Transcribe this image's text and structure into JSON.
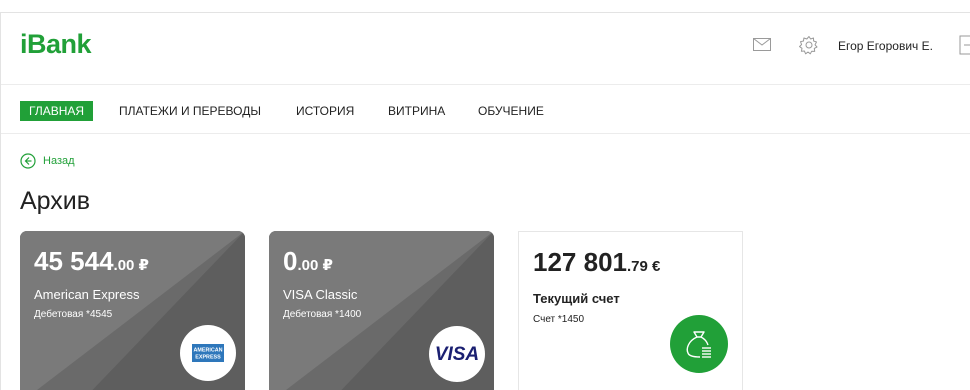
{
  "header": {
    "logo": "iBank",
    "user_name": "Егор Егорович Е.",
    "icons": [
      "mail-icon",
      "gear-icon",
      "logout-icon"
    ]
  },
  "nav": {
    "items": [
      {
        "label": "ГЛАВНАЯ",
        "active": true
      },
      {
        "label": "ПЛАТЕЖИ И ПЕРЕВОДЫ",
        "active": false
      },
      {
        "label": "ИСТОРИЯ",
        "active": false
      },
      {
        "label": "ВИТРИНА",
        "active": false
      },
      {
        "label": "ОБУЧЕНИЕ",
        "active": false
      }
    ]
  },
  "back": {
    "label": "Назад"
  },
  "page_title": "Архив",
  "cards": [
    {
      "amount_main": "45 544",
      "amount_fraction": ".00 ₽",
      "name": "American Express",
      "subtitle": "Дебетовая *4545",
      "logo": "amex-logo",
      "logo_text_top": "AMERICAN",
      "logo_text_bottom": "EXPRESS"
    },
    {
      "amount_main": "0",
      "amount_fraction": ".00 ₽",
      "name": "VISA Classic",
      "subtitle": "Дебетовая *1400",
      "logo": "visa-logo",
      "logo_text": "VISA"
    },
    {
      "amount_main": "127 801",
      "amount_fraction": ".79 €",
      "name": "Текущий счет",
      "subtitle": "Счет *1450",
      "icon": "money-bag-icon"
    }
  ],
  "colors": {
    "brand_green": "#21a038",
    "card_gray": "#6a6a6a",
    "text": "#222222"
  }
}
